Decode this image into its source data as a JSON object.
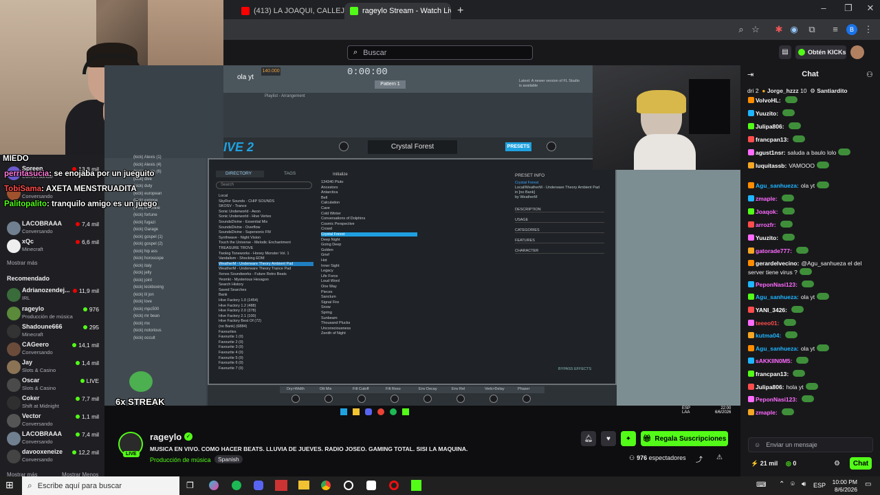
{
  "browser": {
    "tabs": [
      {
        "title": "(413) LA JOAQUI, CALLEJERO F...",
        "favicon_color": "#ff0000"
      },
      {
        "title": "rageylo Stream - Watch Live on...",
        "favicon_color": "#53fc18"
      }
    ]
  },
  "twitch": {
    "search_placeholder": "Buscar",
    "kicks_label": "Obtén KICKs"
  },
  "overlay_chat": [
    {
      "user": "MIEDO",
      "text": ""
    },
    {
      "user": "perritasucia",
      "text": ": se enojaba por un jueguito"
    },
    {
      "user": "TobiSama",
      "text": ": AXETA MENSTRUADITA"
    },
    {
      "user": "Palitopalito",
      "text": ": tranquilo amigo es un juego"
    }
  ],
  "stream_counter": "6x STREAK",
  "left_sidebar": {
    "following": [
      {
        "name": "Spreen",
        "category": "Conversando",
        "viewers": "13,8 mil",
        "color": "#6a5acd"
      },
      {
        "name": "momo",
        "category": "Conversando",
        "viewers": "",
        "color": "#a0522d"
      },
      {
        "name": "LACOBRAAA",
        "category": "Conversando",
        "viewers": "7,4 mil",
        "color": "#708090"
      },
      {
        "name": "xQc",
        "category": "Minecraft",
        "viewers": "6,6 mil",
        "color": "#eeeeee"
      }
    ],
    "show_more": "Mostrar más",
    "recommended_title": "Recomendado",
    "recommended": [
      {
        "name": "Adrianozendej...",
        "category": "IRL",
        "viewers": "11,9 mil",
        "color": "#3a6b3a"
      },
      {
        "name": "rageylo",
        "category": "Producción de música",
        "viewers": "976",
        "color": "#5a8a3a"
      },
      {
        "name": "Shadoune666",
        "category": "Minecraft",
        "viewers": "295",
        "color": "#333333"
      },
      {
        "name": "CAGeero",
        "category": "Conversando",
        "viewers": "14,1 mil",
        "color": "#6b4c3b"
      },
      {
        "name": "Jay",
        "category": "Slots & Casino",
        "viewers": "1,4 mil",
        "color": "#8b7355"
      },
      {
        "name": "Oscar",
        "category": "Slots & Casino",
        "viewers": "LIVE",
        "color": "#4a4a4a"
      },
      {
        "name": "Coker",
        "category": "Shift at Midnight",
        "viewers": "7,7 mil",
        "color": "#2f2f2f"
      },
      {
        "name": "Vector",
        "category": "Conversando",
        "viewers": "1,1 mil",
        "color": "#555555"
      },
      {
        "name": "LACOBRAAA",
        "category": "Conversando",
        "viewers": "7,4 mil",
        "color": "#708090"
      },
      {
        "name": "davooxeneize",
        "category": "Conversando",
        "viewers": "12,2 mil",
        "color": "#444444"
      }
    ],
    "show_more2": "Mostrar más",
    "show_less": "Mostrar Menos"
  },
  "fl": {
    "title_left": "ola yt",
    "tempo": "140.000",
    "time": "0:00:00",
    "pattern": "Pattern 1",
    "playlist": "Playlist - Arrangement",
    "news": "Latest: A newer version of FL Studio is available",
    "plugin_name": "IVE 2",
    "preset": "Crystal Forest",
    "presets_btn": "PRESETS",
    "tabs": [
      "DIRECTORY",
      "TAGS"
    ],
    "search": "Search",
    "initialize": "Initialize",
    "directory": [
      "Local",
      "SkyRor Sounds - CHIP SOUNDS",
      "SKOSV - Trance",
      "Sonic Underworld - Aeon",
      "Sonic Underworld - Hive Vertex",
      "SoundsDivine - Essential Mix",
      "SoundsDivine - Overflow",
      "SoundsDivine - Supersonic FM",
      "Synthwave - Night Vision",
      "Touch the Universe - Melodic Enchantment",
      "TREASURE TROVE",
      "Twoleg Toneworks - Honey Monster Vol. 1",
      "Vandalism - Shocking EDM",
      "WeatherM - Underware Theory Ambient Pad",
      "WeatherM - Underware Theory Trance Pad",
      "Xenos Soundworks - Future Retro Beats",
      "Yeomki - Mysterious Hexagon",
      "Search History",
      "Saved Searches",
      "Bank",
      "Hive Factory 1.0 (1454)",
      "Hive Factory 1.2 (488)",
      "Hive Factory 2.0 (378)",
      "Hive Factory 2.1 (100)",
      "Hive Factory Best Of (72)",
      "(no Bank) (6884)",
      "Favourites",
      "Favourite 1 (0)",
      "Favourite 2 (0)",
      "Favourite 3 (0)",
      "Favourite 4 (0)",
      "Favourite 5 (0)",
      "Favourite 6 (0)",
      "Favourite 7 (0)"
    ],
    "presets": [
      "134340 Pluto",
      "Ancestors",
      "Antarctica",
      "Bell",
      "Calculation",
      "Cave",
      "Cold Winter",
      "Conversations of Dolphins",
      "Cosmic Perspective",
      "Crowd",
      "Crystal Forest",
      "Deep Night",
      "Going Deep",
      "Golden",
      "Grief",
      "Hot",
      "Inner Sight",
      "Legacy",
      "Life Force",
      "Loud Word",
      "One Way",
      "Pieces",
      "Sanctum",
      "Signal Fire",
      "Snow",
      "Spring",
      "Sunbeam",
      "Thousand Plucks",
      "Unconsciousness",
      "Zenith of Night"
    ],
    "preset_info_title": "PRESET INFO",
    "preset_info": [
      "Crystal Forest",
      "Local/WeatherM - Underware Theory Ambient Pad",
      "in [no Bank]",
      "by WeatherM"
    ],
    "preset_fields": [
      "DESCRIPTION",
      "USAGE",
      "CATEGORIES",
      "FEATURES",
      "CHARACTER"
    ],
    "bypass": "BYPASS EFFECTS",
    "macros": [
      "Dry>Width",
      "Ott Mix",
      "Filt Cutoff",
      "Filt Reso",
      "Env Decay",
      "Env Rel",
      "Verb>Delay",
      "Phaser"
    ],
    "kick_list": [
      "(kick) Alexis (1)",
      "(kick) Alexis (4)",
      "(kick) Alexis (6)",
      "(kick) dive",
      "(kick) duty",
      "(kick) european",
      "(kick) expose",
      "(kick) feminine",
      "(kick) fortune",
      "(kick) fugazi",
      "(kick) Garage",
      "(kick) gospel (1)",
      "(kick) gospel (2)",
      "(kick) hip ass",
      "(kick) horoscope",
      "(kick) italy",
      "(kick) jelly",
      "(kick) joint",
      "(kick) kickboxing",
      "(kick) lil jon",
      "(kick) love",
      "(kick) mpc500",
      "(kick) mr bean",
      "(kick) mx",
      "(kick) notorious",
      "(kick) occult"
    ]
  },
  "channel": {
    "name": "rageylo",
    "title": "MUSICA EN VIVO. COMO HACER BEATS. LLUVIA DE JUEVES. RADIO JOSEO. GAMING TOTAL. SISI LA MAQUINA.",
    "category": "Producción de música",
    "language": "Spanish",
    "live_label": "LIVE",
    "gift_label": "Regala Suscripciones",
    "viewers": "976",
    "viewers_label": "espectadores"
  },
  "chat": {
    "title": "Chat",
    "top_gifters": [
      {
        "name": "dri",
        "count": "2"
      },
      {
        "name": "Jorge_hzzz",
        "count": "10"
      },
      {
        "name": "Santiardito",
        "count": ""
      }
    ],
    "messages": [
      {
        "user": "VolvoHL:",
        "text": "",
        "color": "#ffffff"
      },
      {
        "user": "Yuuzito:",
        "text": "",
        "color": "#ffffff"
      },
      {
        "user": "Julipa806:",
        "text": "",
        "color": "#ffffff"
      },
      {
        "user": "francpan13:",
        "text": "",
        "color": "#ffffff"
      },
      {
        "user": "agust1nsr:",
        "text": "saluda a baulo lolo",
        "color": "#ffffff"
      },
      {
        "user": "luquitassb:",
        "text": "VAMOOO",
        "color": "#ffffff"
      },
      {
        "user": "Agu_sanhueza:",
        "text": "ola yt",
        "color": "#1fb5ff"
      },
      {
        "user": "zmaple:",
        "text": "",
        "color": "#ff6bff"
      },
      {
        "user": "Joaqok:",
        "text": "",
        "color": "#ff6bff"
      },
      {
        "user": "arrozfr:",
        "text": "",
        "color": "#ff6bff"
      },
      {
        "user": "Yuuzito:",
        "text": "",
        "color": "#ffffff"
      },
      {
        "user": "gatorade777:",
        "text": "",
        "color": "#ff6bff"
      },
      {
        "user": "gerardelvecino:",
        "text": "@Agu_sanhueza el del server tiene virus ?",
        "color": "#ffffff"
      },
      {
        "user": "PeponNasi123:",
        "text": "",
        "color": "#ff6bff"
      },
      {
        "user": "Agu_sanhueza:",
        "text": "ola yt",
        "color": "#1fb5ff"
      },
      {
        "user": "YANI_3426:",
        "text": "",
        "color": "#ffffff"
      },
      {
        "user": "teeeo01:",
        "text": "",
        "color": "#ff4d4d"
      },
      {
        "user": "kutma04:",
        "text": "",
        "color": "#1fb5ff"
      },
      {
        "user": "Agu_sanhueza:",
        "text": "ola yt",
        "color": "#1fb5ff"
      },
      {
        "user": "sAKKIIN0M5:",
        "text": "",
        "color": "#ff6bff"
      },
      {
        "user": "francpan13:",
        "text": "",
        "color": "#ffffff"
      },
      {
        "user": "Julipa806:",
        "text": "hola yt",
        "color": "#ffffff"
      },
      {
        "user": "PeponNasi123:",
        "text": "",
        "color": "#ff6bff"
      },
      {
        "user": "zmaple:",
        "text": "",
        "color": "#ff6bff"
      }
    ],
    "input_placeholder": "Enviar un mensaje",
    "kicks_count": "21 mil",
    "points": "0",
    "send_label": "Chat"
  },
  "taskbar": {
    "search_placeholder": "Escribe aquí para buscar",
    "lang1": "ESP",
    "lang2": "LAA",
    "time": "10:00 PM",
    "date": "8/6/2026",
    "fl_time": "22:00",
    "fl_date": "6/6/2026"
  },
  "colors": {
    "kick_green": "#53fc18",
    "bg": "#0e0e10",
    "panel": "#18181b"
  }
}
